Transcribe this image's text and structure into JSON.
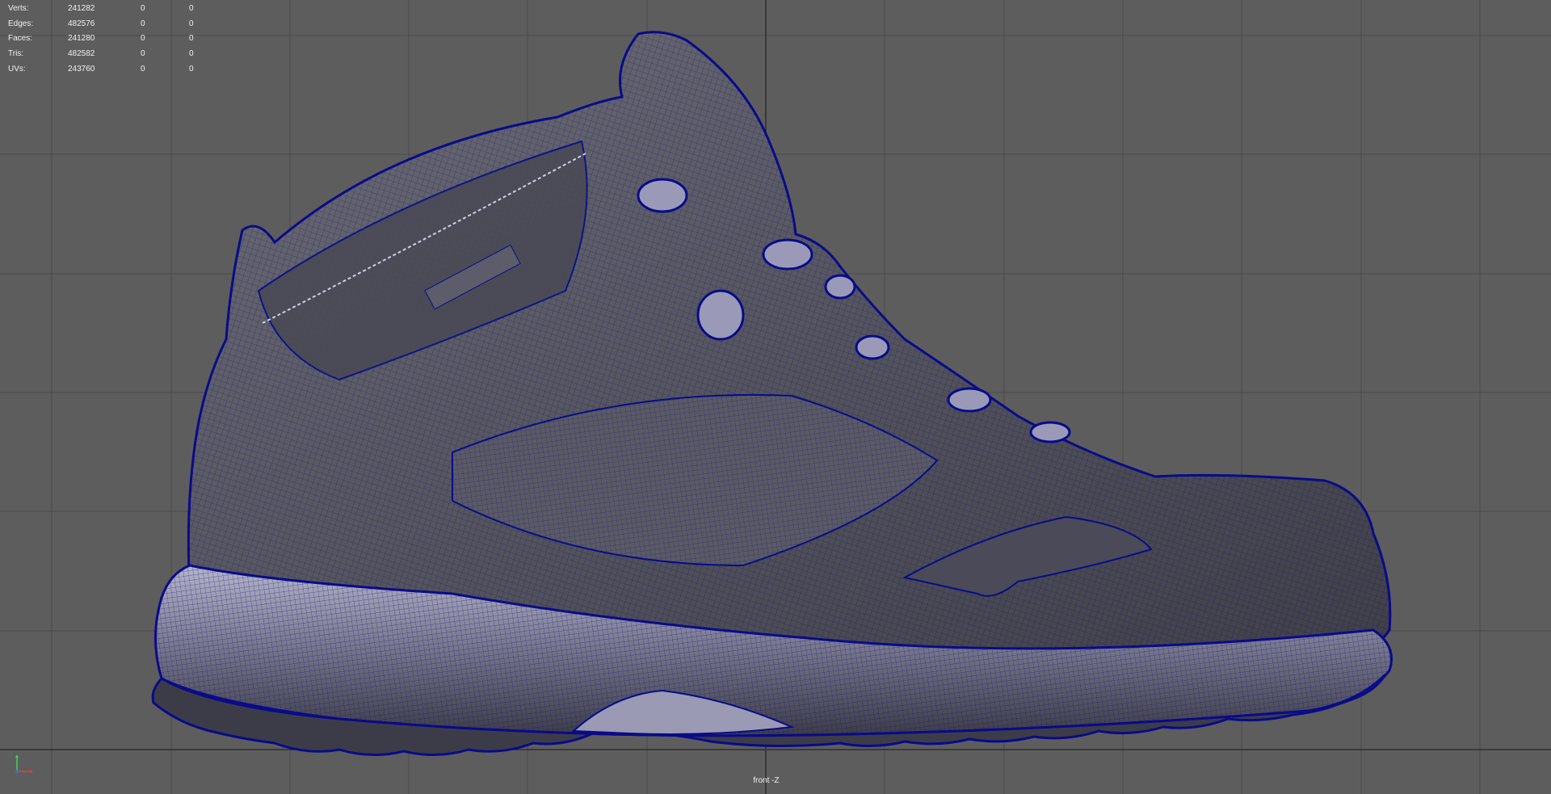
{
  "viewport": {
    "camera": "front -Z",
    "background": "#5d5d5d",
    "wire_color": "#0a0a8a"
  },
  "hud": {
    "rows": [
      {
        "label": "Verts:",
        "v1": "241282",
        "v2": "0",
        "v3": "0"
      },
      {
        "label": "Edges:",
        "v1": "482576",
        "v2": "0",
        "v3": "0"
      },
      {
        "label": "Faces:",
        "v1": "241280",
        "v2": "0",
        "v3": "0"
      },
      {
        "label": "Tris:",
        "v1": "482582",
        "v2": "0",
        "v3": "0"
      },
      {
        "label": "UVs:",
        "v1": "243760",
        "v2": "0",
        "v3": "0"
      }
    ]
  },
  "icons": {
    "axis": "view-axis-icon"
  }
}
